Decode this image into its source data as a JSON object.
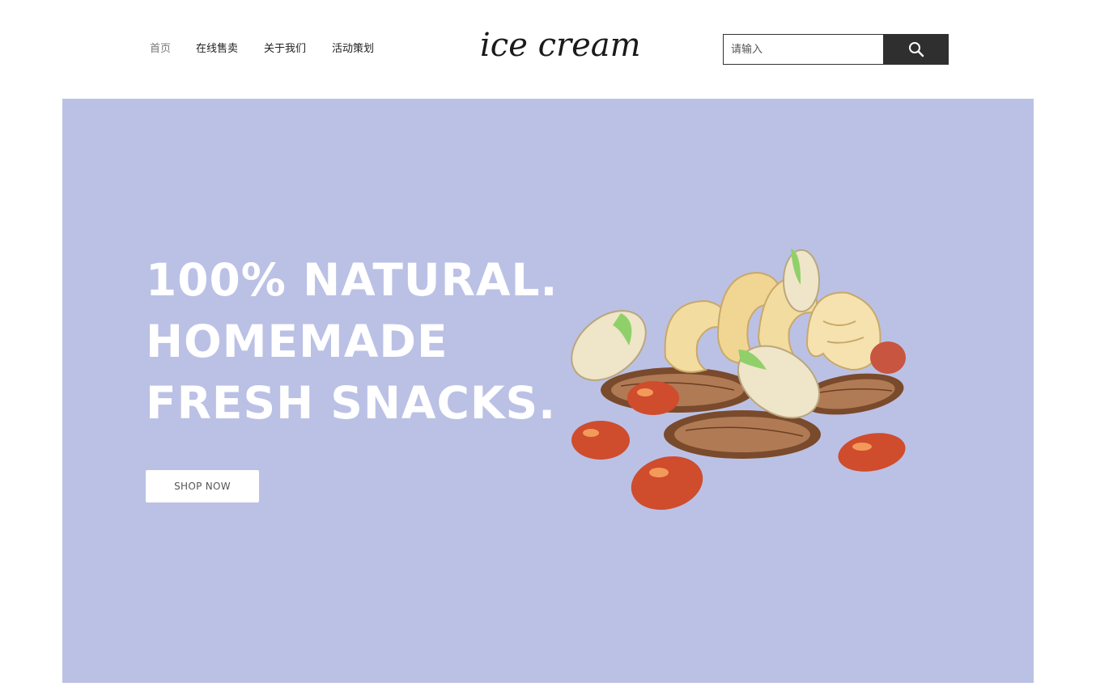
{
  "header": {
    "nav": [
      {
        "label": "首页",
        "active": true
      },
      {
        "label": "在线售卖",
        "active": false
      },
      {
        "label": "关于我们",
        "active": false
      },
      {
        "label": "活动策划",
        "active": false
      }
    ],
    "logo": "ice cream",
    "search": {
      "placeholder": "请输入",
      "value": "",
      "button_icon": "search-icon"
    }
  },
  "hero": {
    "background_color": "#bbc1e5",
    "headline": [
      "100% NATURAL.",
      "HOMEMADE",
      "FRESH SNACKS."
    ],
    "cta_label": "SHOP NOW",
    "illustration": "mixed-nuts-illustration"
  }
}
